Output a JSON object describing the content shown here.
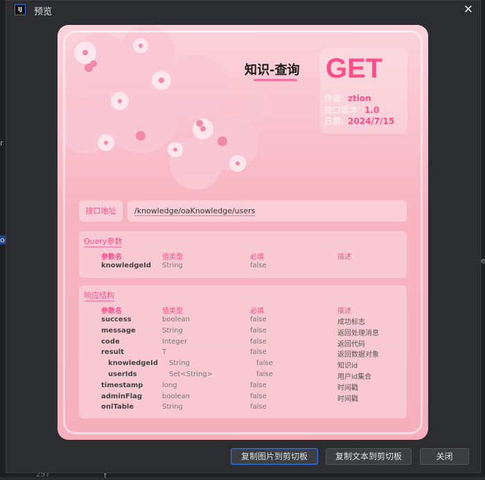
{
  "window": {
    "title": "预览",
    "app_icon": "IJ"
  },
  "ide_fragments": {
    "left_char": "r",
    "left_char2": "on",
    "right_char": "e",
    "line_number": "257",
    "bottom_char": "f"
  },
  "card": {
    "title": "知识-查询",
    "method": "GET",
    "author_label": "作者:",
    "author": "ztion",
    "version_label": "接口版本:",
    "version": "1.0",
    "date_label": "日期:",
    "date": "2024/7/15",
    "url_label": "接口地址",
    "url": "/knowledge/oaKnowledge/users",
    "query": {
      "title": "Query参数",
      "headers": [
        "参数名",
        "值类型",
        "必填",
        "描述"
      ],
      "rows": [
        {
          "name": "knowledgeId",
          "type": "String",
          "required": "false",
          "desc": ""
        }
      ]
    },
    "response": {
      "title": "响应结构",
      "headers": [
        "参数名",
        "值类型",
        "必填",
        "描述"
      ],
      "rows": [
        {
          "name": "success",
          "type": "boolean",
          "required": "false",
          "desc": "成功标志",
          "indent": false
        },
        {
          "name": "message",
          "type": "String",
          "required": "false",
          "desc": "返回处理消息",
          "indent": false
        },
        {
          "name": "code",
          "type": "Integer",
          "required": "false",
          "desc": "返回代码",
          "indent": false
        },
        {
          "name": "result",
          "type": "T",
          "required": "false",
          "desc": "返回数据对象",
          "indent": false
        },
        {
          "name": "knowledgeId",
          "type": "String",
          "required": "false",
          "desc": "知识id",
          "indent": true
        },
        {
          "name": "userIds",
          "type": "Set<String>",
          "required": "false",
          "desc": "用户id集合",
          "indent": true
        },
        {
          "name": "timestamp",
          "type": "long",
          "required": "false",
          "desc": "时间戳",
          "indent": false
        },
        {
          "name": "adminFlag",
          "type": "boolean",
          "required": "false",
          "desc": "时间戳",
          "indent": false
        },
        {
          "name": "onlTable",
          "type": "String",
          "required": "false",
          "desc": "",
          "indent": false
        }
      ]
    }
  },
  "buttons": {
    "copy_image": "复制图片到剪切板",
    "copy_text": "复制文本到剪切板",
    "close": "关闭"
  },
  "colors": {
    "accent": "#ff4f8b",
    "card_bg": "#f7b4c0",
    "dialog_bg": "#2b2d30"
  }
}
